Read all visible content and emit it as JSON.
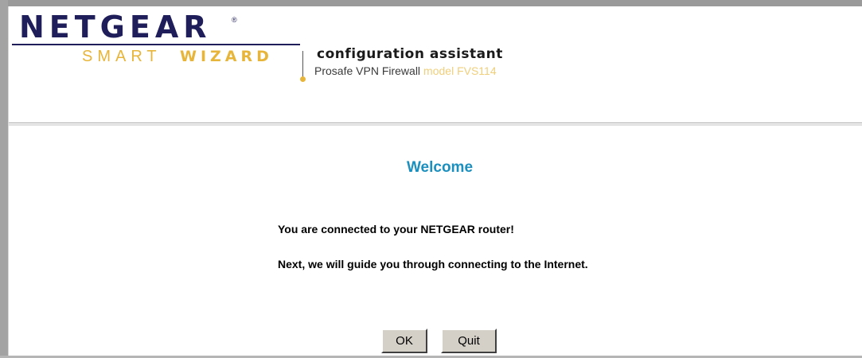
{
  "header": {
    "logo_text": "NETGEAR",
    "logo_reg": "®",
    "smart_text": "SMART",
    "wizard_text": "WIZARD",
    "title": "configuration assistant",
    "product": "Prosafe VPN Firewall",
    "model": "model FVS114"
  },
  "main": {
    "welcome": "Welcome",
    "message_1": "You are connected to your NETGEAR router!",
    "message_2": "Next, we will guide you through connecting to the Internet."
  },
  "buttons": {
    "ok_label": "OK",
    "quit_label": "Quit"
  },
  "colors": {
    "brand_navy": "#1f1e5a",
    "brand_gold": "#e7b53a",
    "welcome_blue": "#1b8fbe"
  }
}
